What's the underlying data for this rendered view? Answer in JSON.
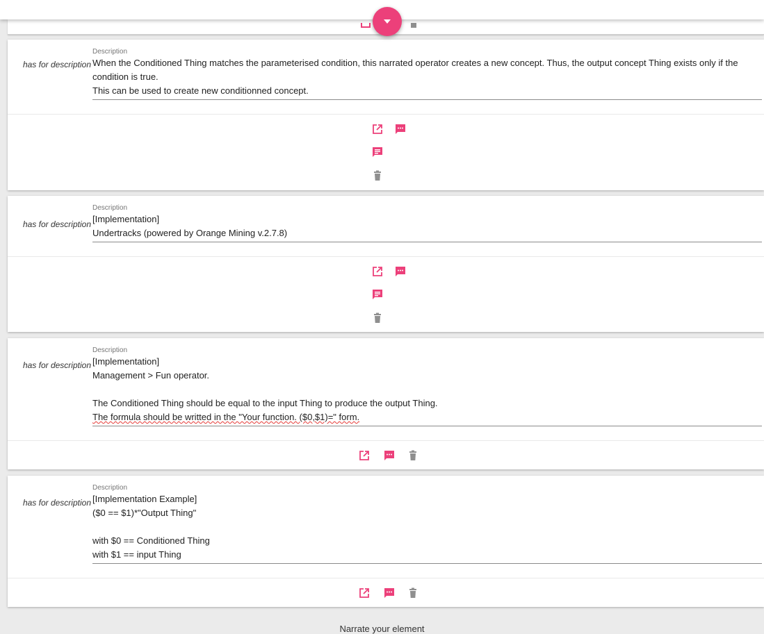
{
  "colors": {
    "accent": "#ec407a",
    "delete_icon": "#8f8f8f",
    "page_background": "#ebebeb"
  },
  "top_bar": {
    "fab_icon": "caret-down-icon"
  },
  "icons": {
    "edit": "open-in-new-icon",
    "comment": "comment-icon",
    "notes": "notes-icon",
    "delete": "trash-icon"
  },
  "cards": [
    {
      "property": "has for description",
      "field_label": "Description",
      "lines": [
        "When the Conditioned Thing matches the parameterised condition, this narrated operator creates a new concept. Thus, the output concept Thing exists only if the",
        "condition is true.",
        "This can be used to create new conditionned concept."
      ]
    },
    {
      "property": "has for description",
      "field_label": "Description",
      "lines": [
        "[Implementation]",
        "Undertracks (powered by Orange Mining v.2.7.8)"
      ]
    },
    {
      "property": "has for description",
      "field_label": "Description",
      "lines": [
        "[Implementation]",
        "Management > Fun operator.",
        "",
        "The Conditioned Thing should be equal to the input Thing to produce the output Thing.",
        "The formula should be writted in the \"Your function. ($0,$1)=\" form."
      ]
    },
    {
      "property": "has for description",
      "field_label": "Description",
      "lines": [
        "[Implementation Example]",
        "($0 == $1)*\"Output Thing\"",
        "",
        "with $0 == Conditioned Thing",
        "with $1 == input Thing"
      ]
    }
  ],
  "footer": {
    "narrate_label": "Narrate your element"
  }
}
